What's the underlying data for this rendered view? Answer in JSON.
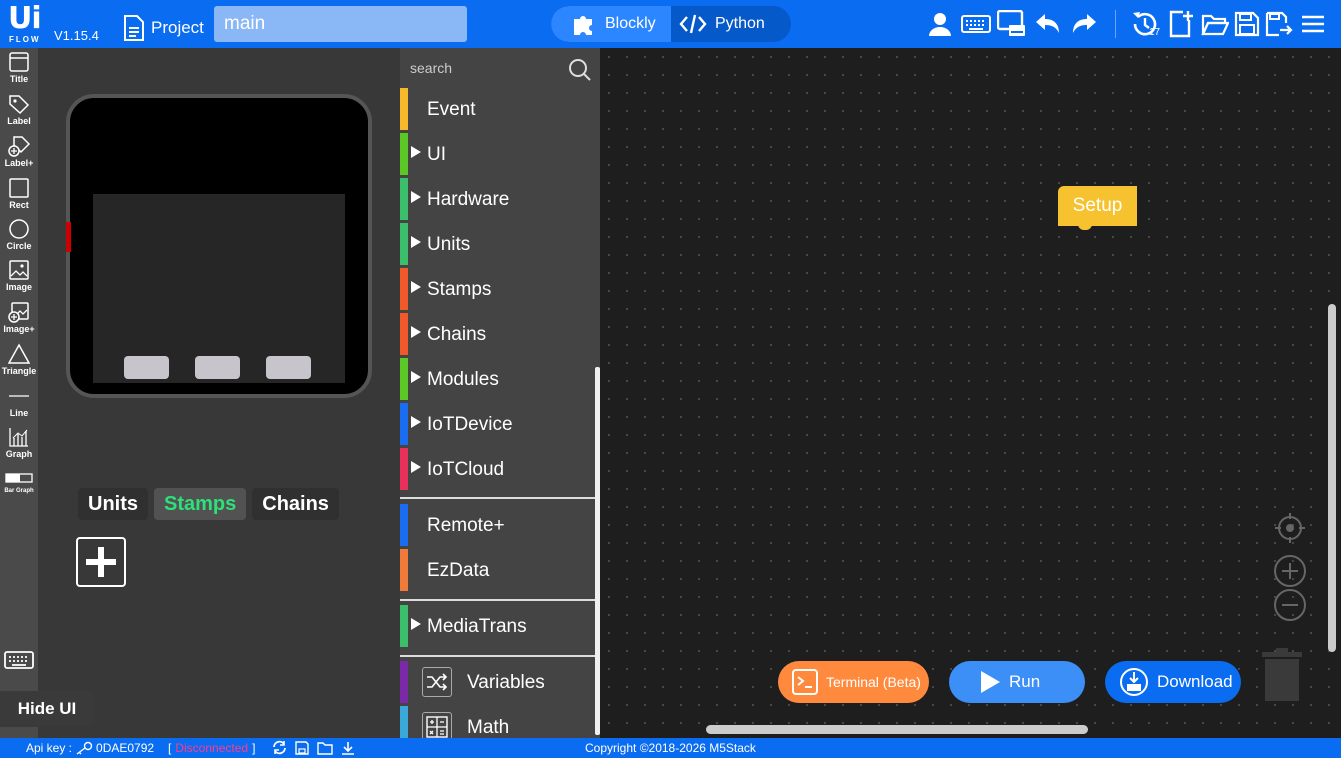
{
  "header": {
    "logo_big": "Ui",
    "logo_small": "FLOW",
    "version": "V1.15.4",
    "project_label": "Project",
    "filename": "main",
    "modes": {
      "blockly": "Blockly",
      "python": "Python",
      "active": "blockly"
    },
    "icons": [
      "user-icon",
      "keyboard-icon",
      "device-icon",
      "undo-icon",
      "redo-icon",
      "ota-history-icon",
      "new-file-icon",
      "open-folder-icon",
      "save-icon",
      "save-as-icon",
      "menu-icon"
    ],
    "ota_count": "17"
  },
  "toolbar": {
    "items": [
      {
        "label": "Title",
        "icon": "title-icon"
      },
      {
        "label": "Label",
        "icon": "tag-icon"
      },
      {
        "label": "Label+",
        "icon": "tag-plus-icon"
      },
      {
        "label": "Rect",
        "icon": "rect-icon"
      },
      {
        "label": "Circle",
        "icon": "circle-icon"
      },
      {
        "label": "Image",
        "icon": "image-icon"
      },
      {
        "label": "Image+",
        "icon": "image-plus-icon"
      },
      {
        "label": "Triangle",
        "icon": "triangle-icon"
      },
      {
        "label": "Line",
        "icon": "line-icon"
      },
      {
        "label": "Graph",
        "icon": "graph-icon"
      },
      {
        "label": "Bar Graph",
        "icon": "bar-graph-icon"
      }
    ]
  },
  "ui_panel": {
    "tabs": [
      {
        "label": "Units"
      },
      {
        "label": "Stamps"
      },
      {
        "label": "Chains"
      }
    ],
    "active_tab": "Stamps",
    "hide_ui": "Hide UI"
  },
  "categories": {
    "search_placeholder": "search",
    "items": [
      {
        "name": "Event",
        "color": "#f6b92b",
        "arrow": false
      },
      {
        "name": "UI",
        "color": "#5cc826",
        "arrow": true
      },
      {
        "name": "Hardware",
        "color": "#3bbf6a",
        "arrow": true
      },
      {
        "name": "Units",
        "color": "#3bbf6a",
        "arrow": true
      },
      {
        "name": "Stamps",
        "color": "#f05a2a",
        "arrow": true
      },
      {
        "name": "Chains",
        "color": "#f05a2a",
        "arrow": true
      },
      {
        "name": "Modules",
        "color": "#5cc826",
        "arrow": true
      },
      {
        "name": "IoTDevice",
        "color": "#1a6cf0",
        "arrow": true
      },
      {
        "name": "IoTCloud",
        "color": "#e8305a",
        "arrow": true
      },
      {
        "name": "Remote+",
        "color": "#1a6cf0",
        "arrow": false
      },
      {
        "name": "EzData",
        "color": "#f07a3a",
        "arrow": false
      },
      {
        "name": "MediaTrans",
        "color": "#3bbf6a",
        "arrow": true
      },
      {
        "name": "Variables",
        "color": "#7a2aa8",
        "arrow": false,
        "icon": "shuffle-icon"
      },
      {
        "name": "Math",
        "color": "#3aa8d8",
        "arrow": false,
        "icon": "calculator-icon"
      }
    ]
  },
  "workspace": {
    "setup_block": "Setup",
    "terminal_btn": "Terminal (Beta)",
    "run_btn": "Run",
    "download_btn": "Download"
  },
  "footer": {
    "api_label": "Api key :",
    "api_key": "0DAE0792",
    "bracket_open": "[",
    "status": "Disconnected",
    "bracket_close": "]",
    "copyright": "Copyright ©2018-2026 M5Stack"
  },
  "colors": {
    "header_bg": "#0a6cf0",
    "accent_active": "#2ee07a",
    "status_disconnected": "#ff3b8d",
    "setup_block": "#f6c22f"
  }
}
